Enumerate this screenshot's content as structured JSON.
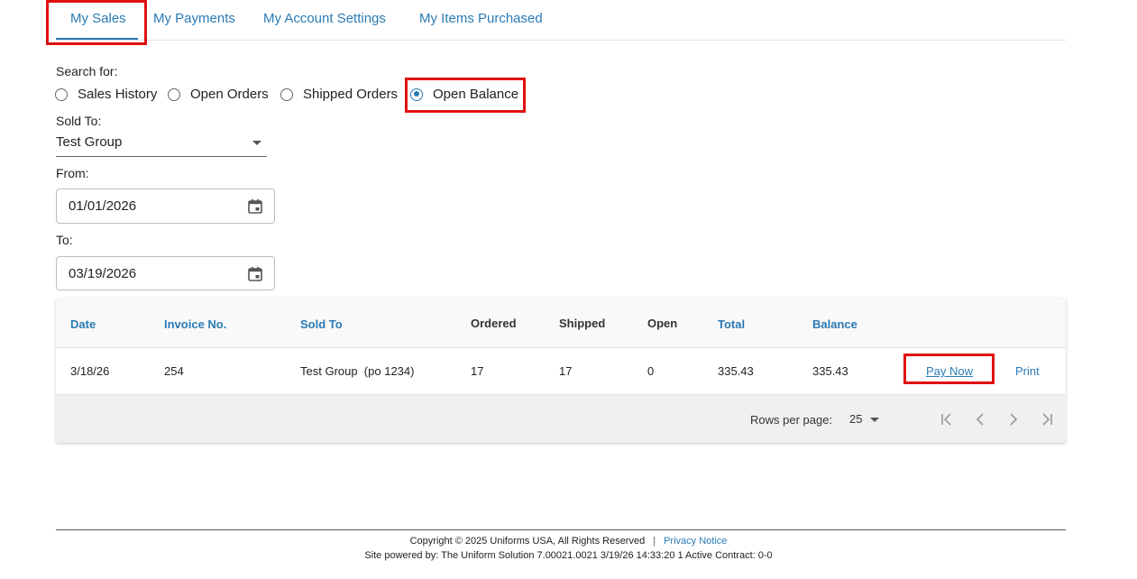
{
  "tabs": [
    {
      "label": "My Sales",
      "active": true
    },
    {
      "label": "My Payments",
      "active": false
    },
    {
      "label": "My Account Settings",
      "active": false
    },
    {
      "label": "My Items Purchased",
      "active": false
    }
  ],
  "search": {
    "label": "Search for:",
    "options": [
      "Sales History",
      "Open Orders",
      "Shipped Orders",
      "Open Balance"
    ],
    "selected": "Open Balance"
  },
  "sold_to": {
    "label": "Sold To:",
    "value": "Test Group"
  },
  "from": {
    "label": "From:",
    "value": "01/01/2026"
  },
  "to": {
    "label": "To:",
    "value": "03/19/2026"
  },
  "table": {
    "columns": [
      "Date",
      "Invoice No.",
      "Sold To",
      "Ordered",
      "Shipped",
      "Open",
      "Total",
      "Balance"
    ],
    "rows": [
      {
        "date": "3/18/26",
        "invoice": "254",
        "sold_to": "Test Group  (po 1234)",
        "ordered": "17",
        "shipped": "17",
        "open": "0",
        "total": "335.43",
        "balance": "335.43",
        "pay_label": "Pay Now",
        "print_label": "Print"
      }
    ]
  },
  "pagination": {
    "rows_per_page_label": "Rows per page:",
    "rows_per_page": "25"
  },
  "footer": {
    "copyright": "Copyright © 2025 Uniforms USA, All Rights Reserved",
    "separator": "|",
    "privacy": "Privacy Notice",
    "powered": "Site powered by: The Uniform Solution 7.00021.0021 3/19/26 14:33:20 1 Active Contract: 0-0"
  },
  "colors": {
    "accent": "#2a7bb5",
    "highlight": "#e01010"
  }
}
